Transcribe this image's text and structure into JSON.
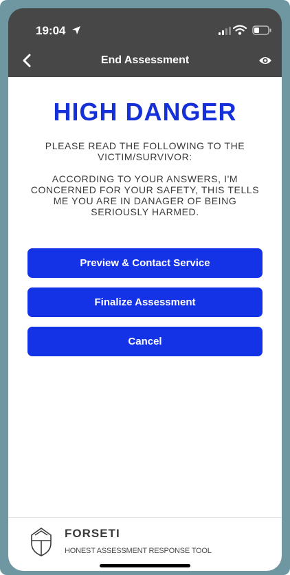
{
  "status_bar": {
    "time": "19:04"
  },
  "nav_bar": {
    "title": "End Assessment"
  },
  "main": {
    "headline": "HIGH DANGER",
    "instruction": "PLEASE READ THE FOLLOWING TO THE VICTIM/SURVIVOR:",
    "script": "ACCORDING TO YOUR ANSWERS, I'M CONCERNED FOR YOUR SAFETY, THIS TELLS ME YOU ARE IN DANAGER OF BEING SERIOUSLY HARMED.",
    "buttons": {
      "preview_contact": "Preview & Contact Service",
      "finalize": "Finalize Assessment",
      "cancel": "Cancel"
    }
  },
  "footer": {
    "brand": "FORSETI",
    "tagline": "HONEST ASSESSMENT RESPONSE TOOL"
  },
  "colors": {
    "accent": "#1433e6",
    "headline": "#1530d8",
    "nav_background": "#474747",
    "frame": "#6e97a2"
  },
  "icons": {
    "back": "chevron-left-icon",
    "visibility": "eye-icon",
    "location": "location-arrow-icon",
    "logo": "forseti-shield-logo"
  }
}
